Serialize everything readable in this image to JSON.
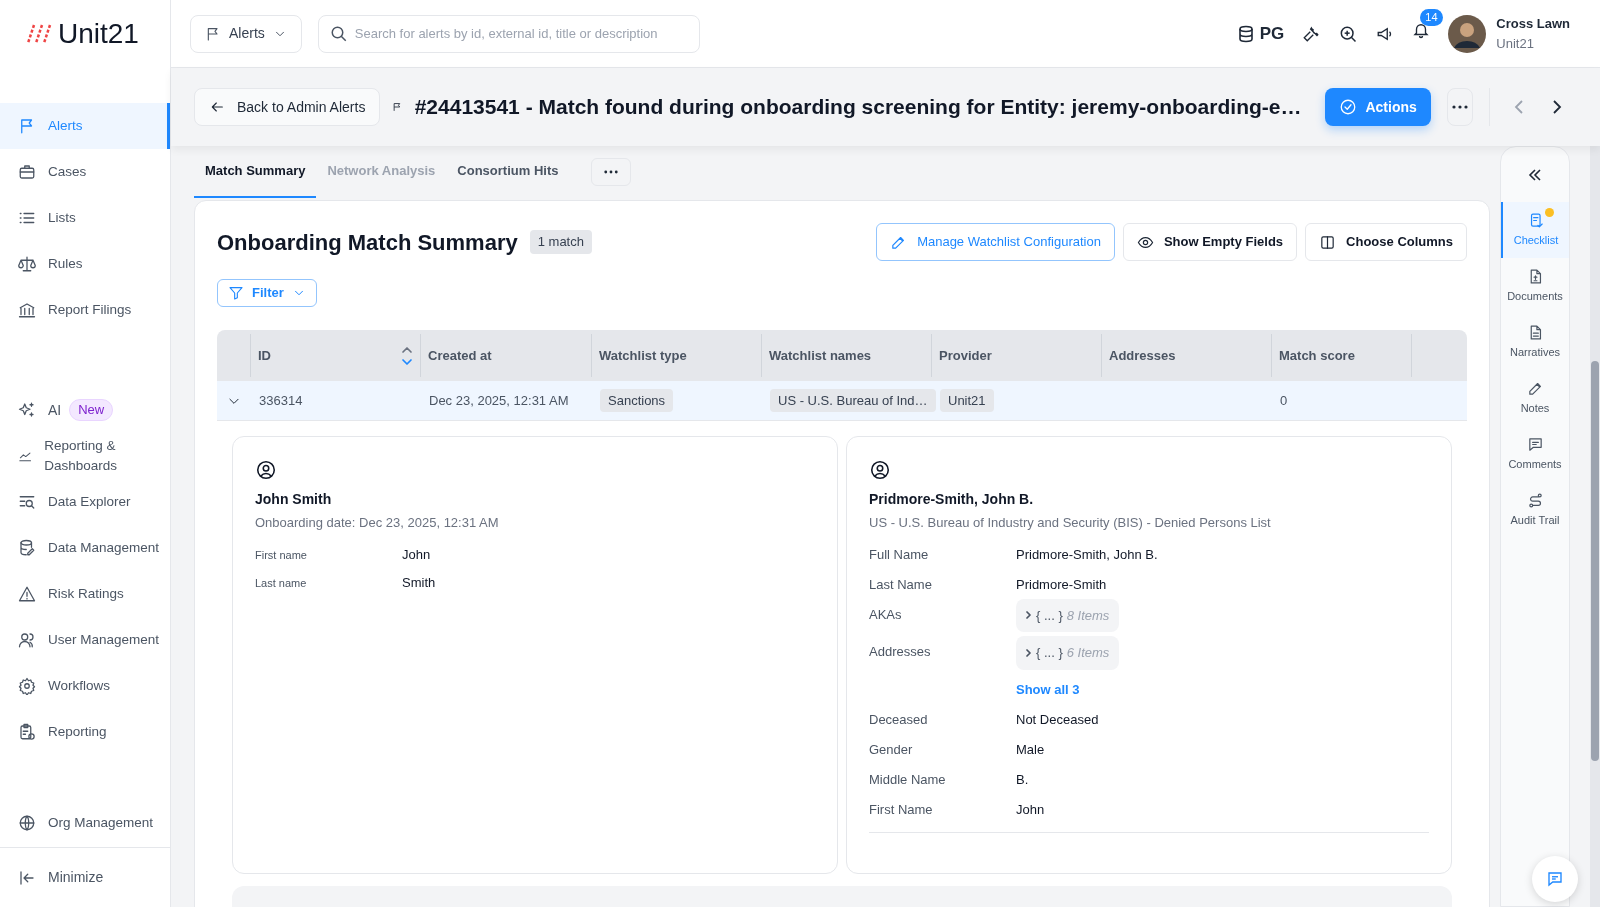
{
  "brand": {
    "name": "Unit21"
  },
  "sidebar": {
    "groups": [
      [
        {
          "label": "Alerts",
          "selected": true
        },
        {
          "label": "Cases",
          "selected": false
        },
        {
          "label": "Lists",
          "selected": false
        },
        {
          "label": "Rules",
          "selected": false
        },
        {
          "label": "Report Filings",
          "selected": false
        }
      ],
      [
        {
          "label": "AI",
          "badge": "New",
          "selected": false
        },
        {
          "label": "Reporting & Dashboards",
          "selected": false
        },
        {
          "label": "Data Explorer",
          "selected": false
        },
        {
          "label": "Data Management",
          "selected": false
        },
        {
          "label": "Risk Ratings",
          "selected": false
        },
        {
          "label": "User Management",
          "selected": false
        },
        {
          "label": "Workflows",
          "selected": false
        },
        {
          "label": "Reporting",
          "selected": false
        }
      ],
      [
        {
          "label": "Org Management",
          "selected": false
        }
      ]
    ],
    "minimize": "Minimize"
  },
  "topbar": {
    "scope": "Alerts",
    "search_placeholder": "Search for alerts by id, external id, title or description",
    "env": "PG",
    "notifications": "14",
    "user": {
      "name": "Cross Lawn",
      "org": "Unit21"
    }
  },
  "header": {
    "back": "Back to Admin Alerts",
    "title": "#24413541 - Match found during onboarding screening for Entity: jeremy-onboarding-e…",
    "actions": "Actions"
  },
  "tabs": [
    {
      "label": "Match Summary",
      "selected": true
    },
    {
      "label": "Network Analysis",
      "selected": false
    },
    {
      "label": "Consortium Hits",
      "selected": false
    }
  ],
  "summary": {
    "title": "Onboarding Match Summary",
    "count": "1 match",
    "buttons": [
      {
        "label": "Manage Watchlist Configuration",
        "kind": "primary"
      },
      {
        "label": "Show Empty Fields",
        "kind": "eye"
      },
      {
        "label": "Choose Columns",
        "kind": "columns"
      }
    ],
    "filter": "Filter"
  },
  "table": {
    "columns": [
      "ID",
      "Created at",
      "Watchlist type",
      "Watchlist names",
      "Provider",
      "Addresses",
      "Match score"
    ],
    "rows": [
      {
        "expanded": true,
        "cells": [
          {
            "text": "336314"
          },
          {
            "text": "Dec 23, 2025, 12:31 AM"
          },
          {
            "text": "Sanctions",
            "tag": true
          },
          {
            "text": "US - U.S. Bureau of Ind…",
            "tag": true
          },
          {
            "text": "Unit21",
            "tag": true
          },
          {
            "text": ""
          },
          {
            "text": "0"
          }
        ]
      }
    ]
  },
  "entity": {
    "name": "John Smith",
    "subtitle": "Onboarding date: Dec 23, 2025, 12:31 AM",
    "fields": [
      {
        "label": "First name",
        "value": "John"
      },
      {
        "label": "Last name",
        "value": "Smith"
      }
    ]
  },
  "match": {
    "name": "Pridmore-Smith, John B.",
    "subtitle": "US - U.S. Bureau of Industry and Security (BIS) - Denied Persons List",
    "fields": [
      {
        "label": "Full Name",
        "kind": "text",
        "value": "Pridmore-Smith, John B."
      },
      {
        "label": "Last Name",
        "kind": "text",
        "value": "Pridmore-Smith"
      },
      {
        "label": "AKAs",
        "kind": "collapsed",
        "value": "{ ... }",
        "count": "8 Items"
      },
      {
        "label": "Addresses",
        "kind": "collapsed",
        "value": "{ ... }",
        "count": "6 Items"
      },
      {
        "kind": "link",
        "value": "Show all 3"
      },
      {
        "label": "Deceased",
        "kind": "text",
        "value": "Not Deceased"
      },
      {
        "label": "Gender",
        "kind": "text",
        "value": "Male"
      },
      {
        "label": "Middle Name",
        "kind": "text",
        "value": "B."
      },
      {
        "label": "First Name",
        "kind": "text",
        "value": "John"
      }
    ]
  },
  "side_panel": [
    {
      "label": "Checklist",
      "selected": true,
      "dot": true
    },
    {
      "label": "Documents",
      "selected": false,
      "dot": false
    },
    {
      "label": "Narratives",
      "selected": false,
      "dot": false
    },
    {
      "label": "Notes",
      "selected": false,
      "dot": false
    },
    {
      "label": "Comments",
      "selected": false,
      "dot": false
    },
    {
      "label": "Audit Trail",
      "selected": false,
      "dot": false
    }
  ]
}
